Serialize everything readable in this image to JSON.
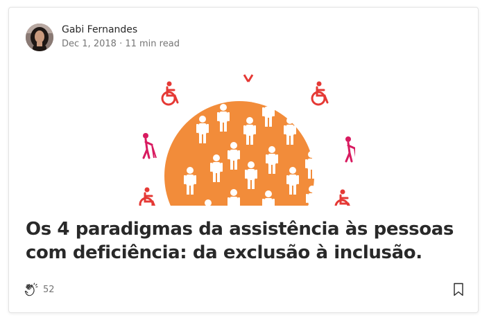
{
  "post": {
    "author": "Gabi Fernandes",
    "date": "Dec 1, 2018",
    "separator": "·",
    "read_time": "11 min read",
    "title": "Os 4 paradigmas da assistência às pessoas com deficiência: da exclusão à inclusão.",
    "claps": "52"
  },
  "colors": {
    "orange": "#f28c3a",
    "red_icon": "#e53935",
    "pink_icon": "#d81b60",
    "text": "#292929",
    "muted": "#757575"
  },
  "icons": {
    "clap": "clap-icon",
    "bookmark": "bookmark-icon"
  }
}
